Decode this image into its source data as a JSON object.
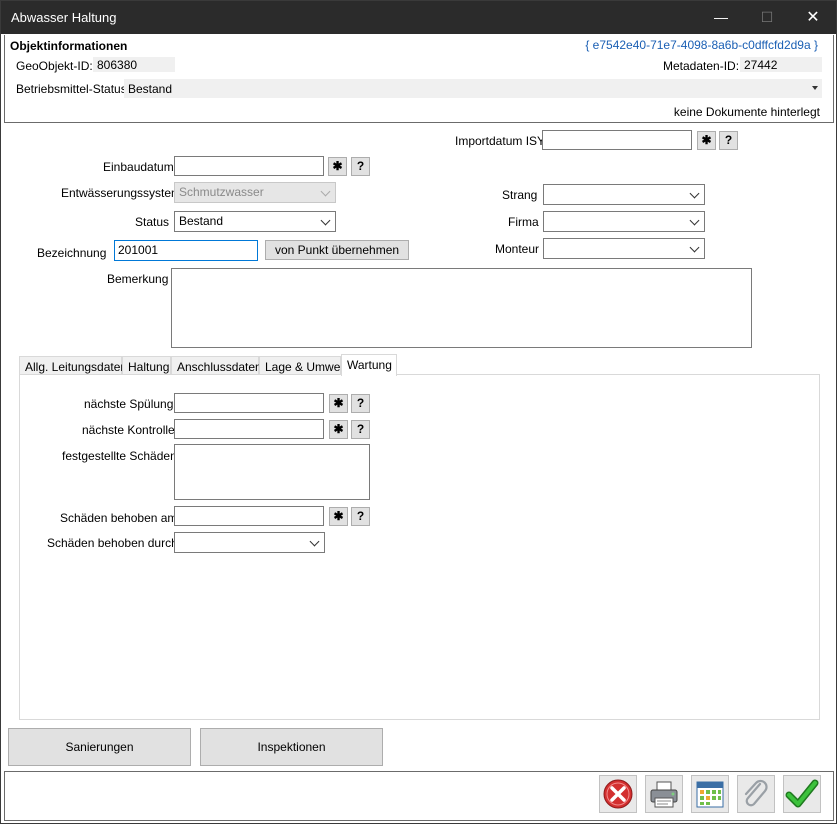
{
  "window": {
    "title": "Abwasser Haltung",
    "minimize": "—",
    "maximize": "☐",
    "close": "✕"
  },
  "info": {
    "heading": "Objektinformationen",
    "guid": "{ e7542e40-71e7-4098-8a6b-c0dffcfd2d9a }",
    "geo_label": "GeoObjekt-ID:",
    "geo_value": "806380",
    "meta_label": "Metadaten-ID:",
    "meta_value": "27442",
    "status_label": "Betriebsmittel-Status:",
    "status_value": "Bestand",
    "documents": "keine Dokumente hinterlegt"
  },
  "form": {
    "import_label": "Importdatum ISY",
    "import_value": "",
    "einbau_label": "Einbaudatum",
    "einbau_value": "",
    "entw_label": "Entwässerungssystem",
    "entw_value": "Schmutzwasser",
    "status_label": "Status",
    "status_value": "Bestand",
    "bez_label": "Bezeichnung",
    "bez_value": "201001",
    "von_punkt": "von Punkt übernehmen",
    "strang_label": "Strang",
    "strang_value": "",
    "firma_label": "Firma",
    "firma_value": "",
    "monteur_label": "Monteur",
    "monteur_value": "",
    "bemerkung_label": "Bemerkung",
    "star": "✱",
    "question": "?"
  },
  "tabs": [
    "Allg. Leitungsdaten",
    "Haltung",
    "Anschlussdaten",
    "Lage & Umwelt",
    "Wartung"
  ],
  "active_tab": "Wartung",
  "wartung": {
    "spuelung_label": "nächste Spülung",
    "spuelung_value": "",
    "kontrolle_label": "nächste Kontrolle",
    "kontrolle_value": "",
    "schaeden_label": "festgestellte Schäden",
    "behoben_am_label": "Schäden behoben am",
    "behoben_am_value": "",
    "behoben_durch_label": "Schäden behoben durch",
    "behoben_durch_value": ""
  },
  "buttons": {
    "sanierungen": "Sanierungen",
    "inspektionen": "Inspektionen"
  },
  "footer_icons": [
    "cancel-icon",
    "print-icon",
    "calendar-icon",
    "attach-icon",
    "ok-check-icon"
  ],
  "colors": {
    "titlebar": "#2b2b2b",
    "guid": "#1a5fb4",
    "cancel": "#d32f2f",
    "ok": "#2e9e2e"
  }
}
